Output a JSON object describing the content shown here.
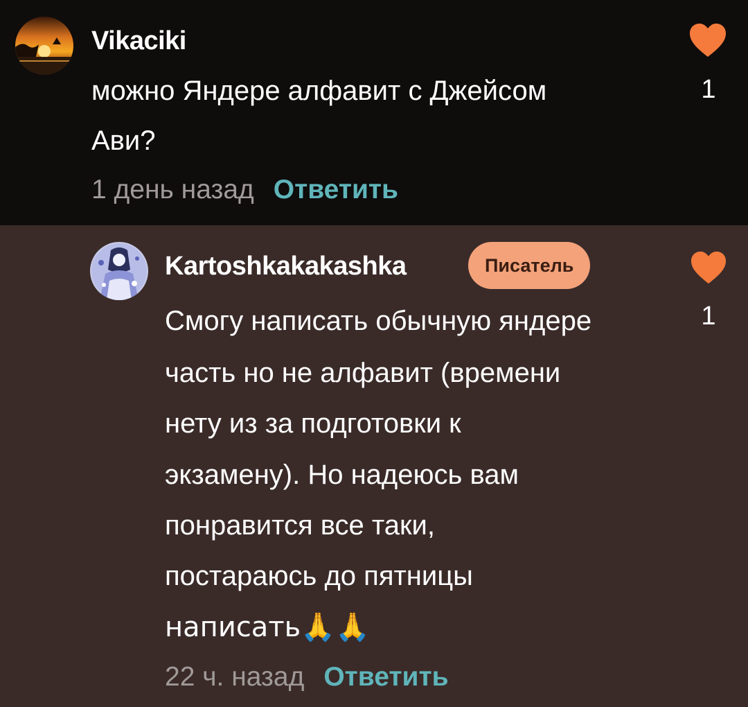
{
  "comments": [
    {
      "username": "Vikaciki",
      "text_lines": [
        "можно Яндере алфавит с Джейсом",
        "Ави?"
      ],
      "time": "1 день назад",
      "reply_label": "Ответить",
      "likes": "1",
      "avatar": "sunset-avatar"
    },
    {
      "username": "Kartoshkakakashka",
      "badge": "Писатель",
      "text_lines": [
        "Смогу написать обычную яндере",
        "часть но не алфавит (времени",
        "нету из за подготовки к",
        "экзамену). Но надеюсь вам",
        "понравится все таки,",
        "постараюсь до пятницы",
        "написать🙏🙏"
      ],
      "time": "22 ч. назад",
      "reply_label": "Ответить",
      "likes": "1",
      "avatar": "anime-avatar"
    }
  ],
  "colors": {
    "top_bg": "#0f0c0c",
    "reply_bg": "#3a2b29",
    "accent_heart": "#f47b3c",
    "reply_link": "#5fb5ba",
    "badge_bg": "#f4a27a"
  }
}
